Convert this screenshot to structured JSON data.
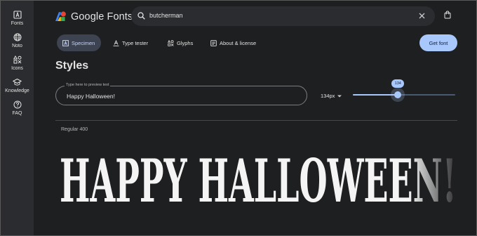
{
  "rail": {
    "items": [
      {
        "label": "Fonts",
        "icon": "fonts-icon"
      },
      {
        "label": "Noto",
        "icon": "globe-icon"
      },
      {
        "label": "Icons",
        "icon": "shapes-icon"
      },
      {
        "label": "Knowledge",
        "icon": "graduation-cap-icon"
      },
      {
        "label": "FAQ",
        "icon": "help-circle-icon"
      }
    ]
  },
  "header": {
    "logo_text": "Google Fonts",
    "search_value": "butcherman"
  },
  "tabs": [
    {
      "label": "Specimen",
      "icon": "specimen-icon",
      "active": true
    },
    {
      "label": "Type tester",
      "icon": "type-tester-icon",
      "active": false
    },
    {
      "label": "Glyphs",
      "icon": "glyphs-icon",
      "active": false
    },
    {
      "label": "About & license",
      "icon": "about-icon",
      "active": false
    }
  ],
  "get_font_label": "Get font",
  "styles": {
    "title": "Styles",
    "preview_placeholder": "Type here to preview text",
    "preview_text": "Happy Halloween!",
    "size_label": "134px",
    "slider_value": "134",
    "slider_fraction": 0.44,
    "style_name": "Regular 400",
    "specimen_text": "HAPPY HALLOWEEN!"
  },
  "colors": {
    "accent": "#a8c7fa",
    "background": "#1e1f21",
    "rail": "#2b2c2f"
  }
}
